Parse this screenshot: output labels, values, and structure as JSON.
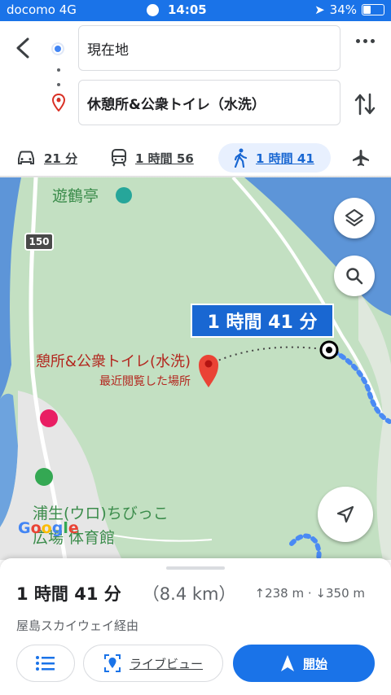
{
  "status_bar": {
    "carrier": "docomo",
    "network": "4G",
    "time": "14:05",
    "battery": "34%"
  },
  "search": {
    "origin": "現在地",
    "destination": "休憩所&公衆トイレ（水洗）"
  },
  "modes": [
    {
      "name": "car",
      "label": "21 分"
    },
    {
      "name": "train",
      "label": "1 時間 56"
    },
    {
      "name": "walk",
      "label": "1 時間 41"
    },
    {
      "name": "plane",
      "label": ""
    }
  ],
  "map": {
    "poi_top": "遊鶴亭",
    "road_number": "150",
    "time_chip": "1 時間 41 分",
    "dest_label": "憩所&公衆トイレ(水洗)",
    "dest_sub": "最近閲覧した場所",
    "poi_bottom_1": "浦生(ウロ)ちびっこ",
    "poi_bottom_2": "広場 体育館",
    "google_letters": [
      "G",
      "o",
      "o",
      "g",
      "l",
      "e"
    ]
  },
  "sheet": {
    "duration": "1 時間 41 分",
    "distance": "（8.4 km）",
    "elevation": "↑238 m · ↓350 m",
    "via": "屋島スカイウェイ経由",
    "live_view": "ライブビュー",
    "start": "開始"
  },
  "colors": {
    "accent": "#1a73e8",
    "map_green": "#c3e0c2",
    "water": "#5d95d8",
    "pin_red": "#d93025"
  }
}
